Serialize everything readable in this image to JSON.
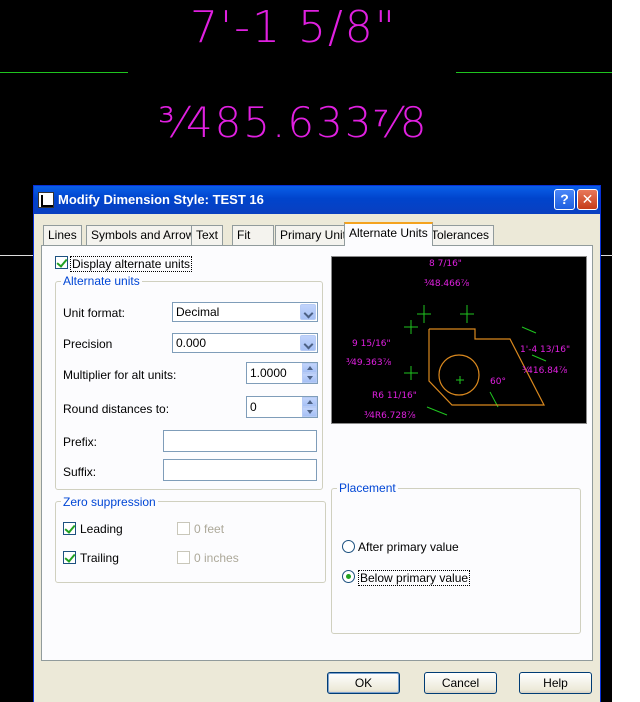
{
  "background": {
    "dim_text_top": "7'-1 5/8\"",
    "dim_text_second": "³⁄485.633⁷⁄8",
    "colors": {
      "dimension_text": "#e020e0",
      "dimension_line": "#1fc41f"
    }
  },
  "dialog": {
    "title": "Modify Dimension Style: TEST 16",
    "help_button": "?",
    "close_button": "✕",
    "tabs": [
      {
        "label": "Lines"
      },
      {
        "label": "Symbols and Arrows"
      },
      {
        "label": "Text"
      },
      {
        "label": "Fit"
      },
      {
        "label": "Primary Units"
      },
      {
        "label": "Alternate Units",
        "active": true
      },
      {
        "label": "Tolerances"
      }
    ],
    "display_alt_units": {
      "label": "Display alternate units",
      "checked": true
    },
    "alt_units_group": {
      "title": "Alternate units",
      "unit_format": {
        "label": "Unit format:",
        "value": "Decimal"
      },
      "precision": {
        "label": "Precision",
        "value": "0.000"
      },
      "multiplier": {
        "label": "Multiplier for alt units:",
        "value": "1.0000"
      },
      "round": {
        "label": "Round distances  to:",
        "value": "0"
      },
      "prefix": {
        "label": "Prefix:",
        "value": ""
      },
      "suffix": {
        "label": "Suffix:",
        "value": ""
      }
    },
    "zero_suppression": {
      "title": "Zero suppression",
      "leading": {
        "label": "Leading",
        "checked": true
      },
      "trailing": {
        "label": "Trailing",
        "checked": true
      },
      "zero_feet": {
        "label": "0 feet",
        "checked": false,
        "enabled": false
      },
      "zero_inches": {
        "label": "0 inches",
        "checked": false,
        "enabled": false
      }
    },
    "preview": {
      "label_top": "8 7/16\"",
      "label_top_alt": "³⁄48.466⅞",
      "label_left": "9 15/16\"",
      "label_left_alt": "³⁄49.363⅞",
      "label_right": "1'-4 13/16\"",
      "label_right_alt": "³⁄416.84⅞",
      "label_radius": "R6 11/16\"",
      "label_radius_alt": "³⁄4R6.728⅞",
      "label_angle": "60°"
    },
    "placement": {
      "title": "Placement",
      "after_primary": {
        "label": "After primary value",
        "selected": false
      },
      "below_primary": {
        "label": "Below primary value",
        "selected": true
      }
    },
    "buttons": {
      "ok": "OK",
      "cancel": "Cancel",
      "help": "Help"
    }
  }
}
